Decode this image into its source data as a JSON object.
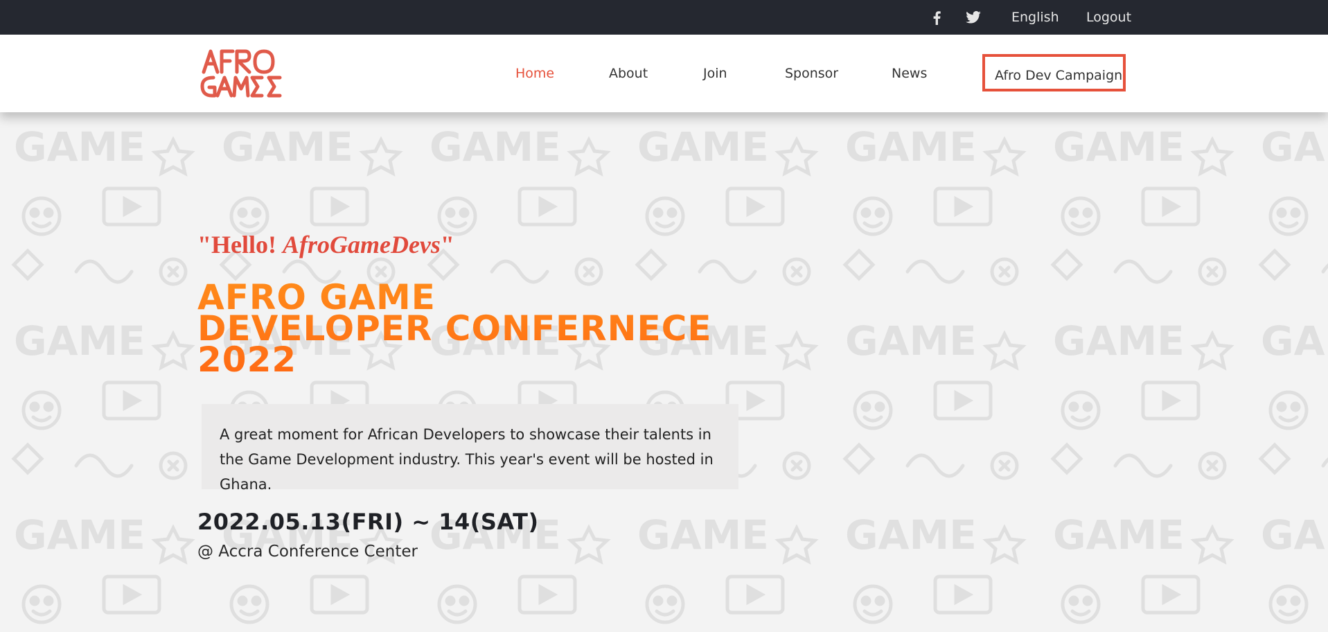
{
  "topbar": {
    "facebook_icon": "facebook-icon",
    "twitter_icon": "twitter-icon",
    "language": "English",
    "logout": "Logout"
  },
  "header": {
    "logo_text_line1": "AFRO",
    "logo_text_line2": "GAMES",
    "nav": {
      "home": "Home",
      "about": "About",
      "join": "Join",
      "sponsor": "Sponsor",
      "news": "News",
      "campaign": "Afro Dev Campaign"
    },
    "active_item": "Home"
  },
  "hero": {
    "greeting_prefix": "\"Hello! ",
    "greeting_name": "AfroGameDevs",
    "greeting_suffix": "\"",
    "title_lines": [
      "AFRO GAME",
      "DEVELOPER CONFERNECE",
      "2022"
    ],
    "description": "A great moment for African Developers to showcase their talents in the Game Development industry. This year's event will be hosted in Ghana.",
    "date": "2022.05.13(FRI) ~ 14(SAT)",
    "venue": "@ Accra Conference Center"
  },
  "colors": {
    "accent": "#e6513b",
    "title_orange": "#ff7a18",
    "topbar_bg": "#252830"
  }
}
